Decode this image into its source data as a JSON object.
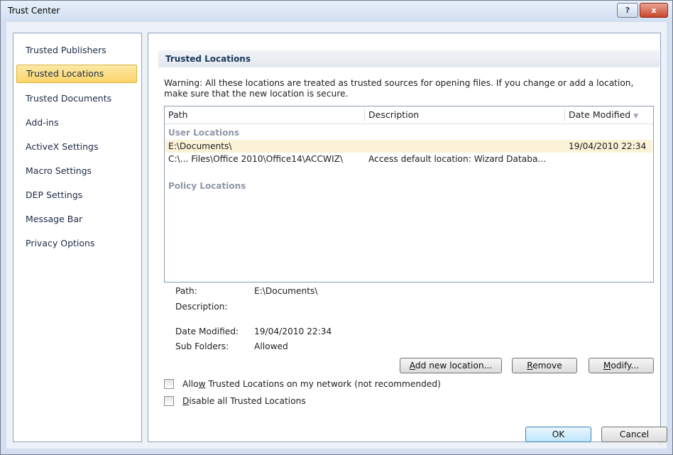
{
  "window": {
    "title": "Trust Center",
    "help_icon": "?",
    "close_icon": "x"
  },
  "sidebar": {
    "items": [
      {
        "label": "Trusted Publishers"
      },
      {
        "label": "Trusted Locations",
        "selected": true
      },
      {
        "label": "Trusted Documents"
      },
      {
        "label": "Add-ins"
      },
      {
        "label": "ActiveX Settings"
      },
      {
        "label": "Macro Settings"
      },
      {
        "label": "DEP Settings"
      },
      {
        "label": "Message Bar"
      },
      {
        "label": "Privacy Options"
      }
    ]
  },
  "main": {
    "section_title": "Trusted Locations",
    "warning": "Warning: All these locations are treated as trusted sources for opening files.  If you change or add a location, make sure that the new location is secure.",
    "list": {
      "columns": [
        "Path",
        "Description",
        "Date Modified"
      ],
      "sort_icon": "sort-descending-icon",
      "groups": [
        {
          "label": "User Locations",
          "rows": [
            {
              "path": "E:\\Documents\\",
              "description": "",
              "date": "19/04/2010 22:34",
              "selected": true
            },
            {
              "path": "C:\\... Files\\Office 2010\\Office14\\ACCWIZ\\",
              "description": "Access default location: Wizard Databa...",
              "date": ""
            }
          ]
        },
        {
          "label": "Policy Locations",
          "rows": []
        }
      ]
    },
    "details": {
      "path_label": "Path:",
      "path_value": "E:\\Documents\\",
      "description_label": "Description:",
      "description_value": "",
      "date_label": "Date Modified:",
      "date_value": "19/04/2010 22:34",
      "subfolders_label": "Sub Folders:",
      "subfolders_value": "Allowed"
    },
    "buttons": {
      "add": {
        "pre": "",
        "key": "A",
        "post": "dd new location..."
      },
      "remove": {
        "pre": "",
        "key": "R",
        "post": "emove"
      },
      "modify": {
        "pre": "",
        "key": "M",
        "post": "odify..."
      }
    },
    "checkboxes": [
      {
        "pre": "Allo",
        "key": "w",
        "post": " Trusted Locations on my network (not recommended)",
        "checked": false
      },
      {
        "pre": "",
        "key": "D",
        "post": "isable all Trusted Locations",
        "checked": false
      }
    ]
  },
  "footer": {
    "ok": "OK",
    "cancel": "Cancel"
  }
}
